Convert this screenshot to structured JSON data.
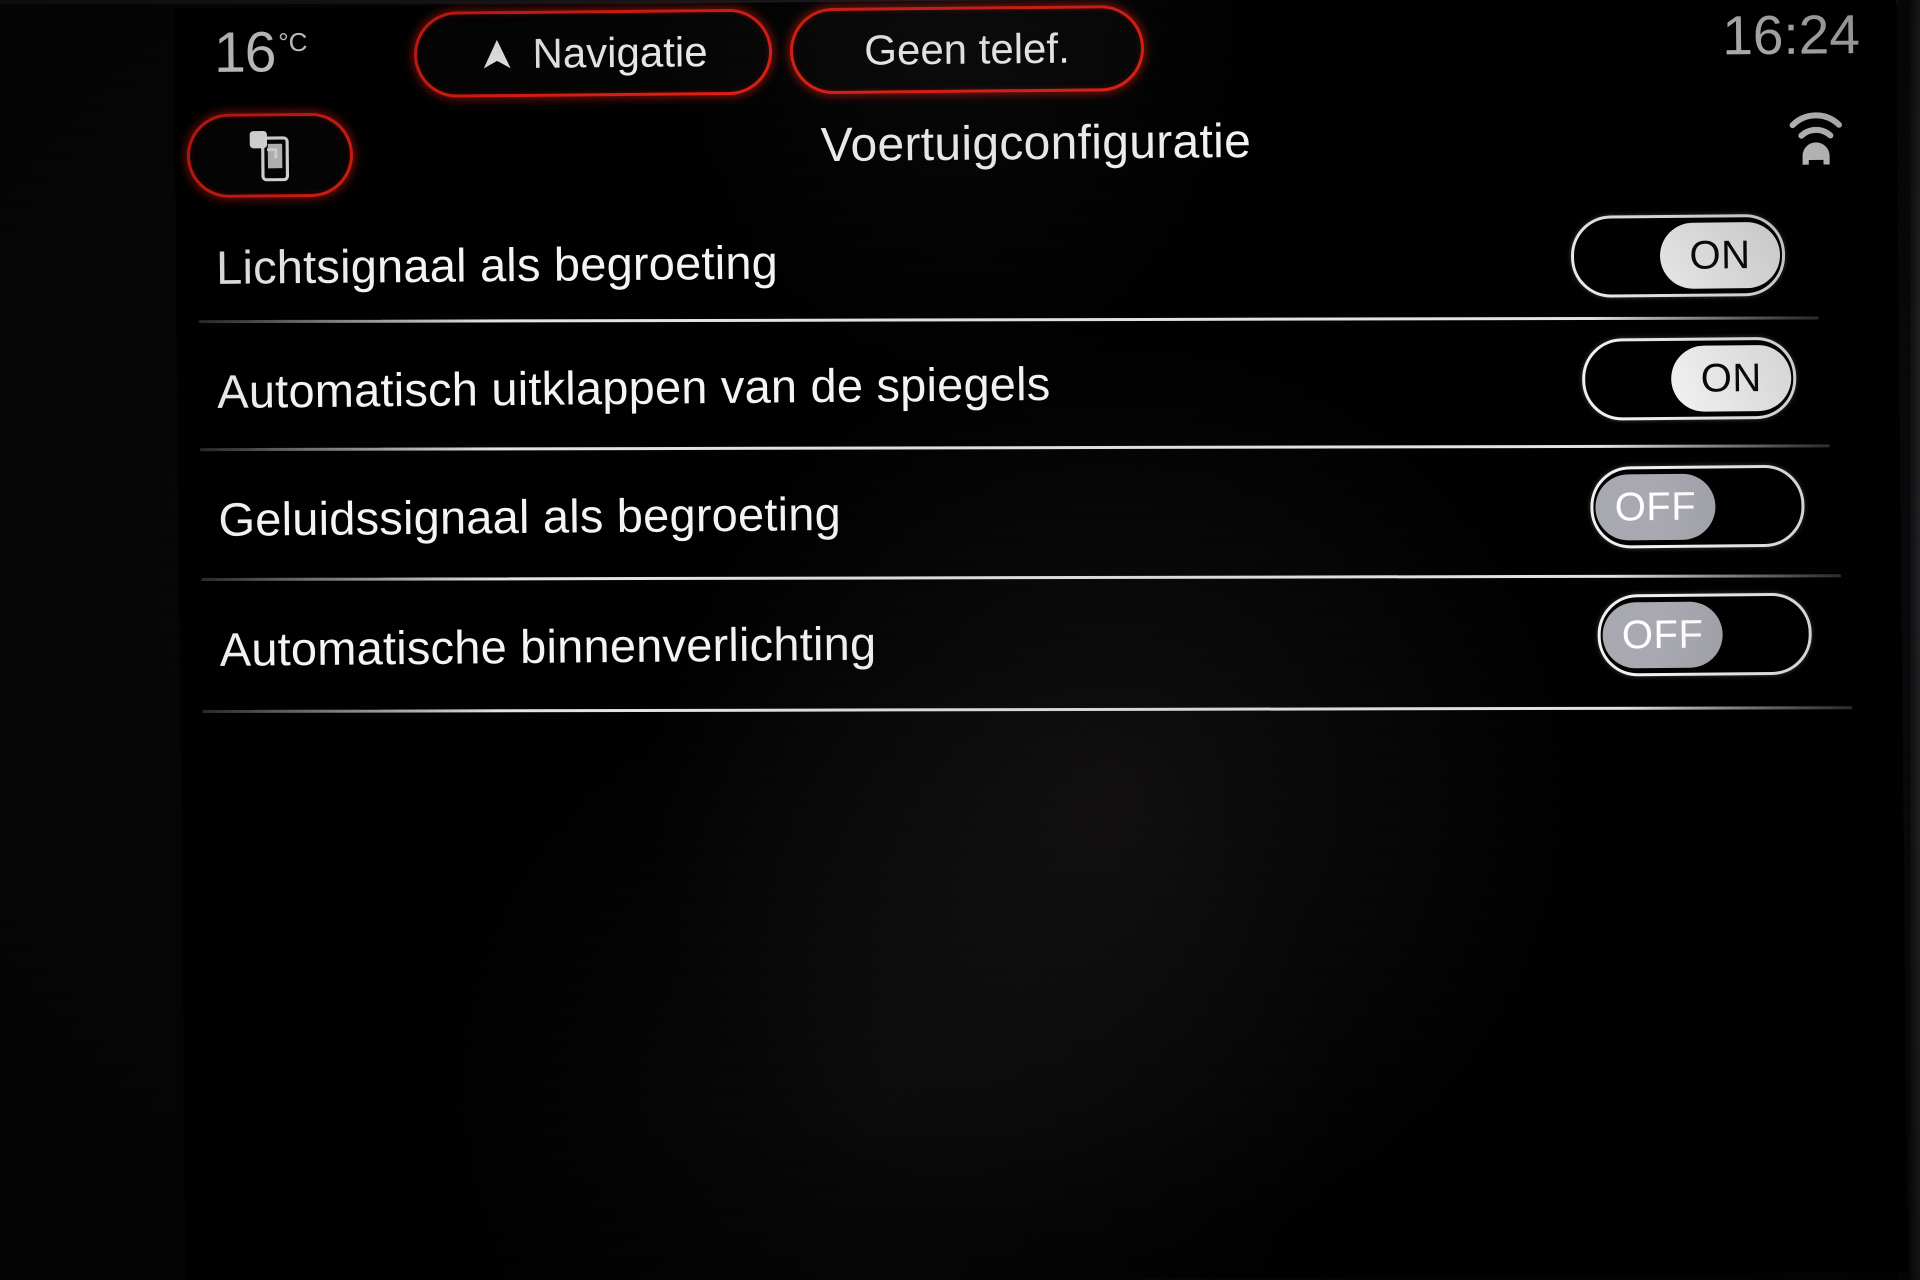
{
  "status_bar": {
    "temperature": "16",
    "temperature_unit": "°C",
    "navigation_label": "Navigatie",
    "navigation_icon": "navigation-arrow-icon",
    "phone_label": "Geen telef.",
    "clock": "16:24"
  },
  "title_bar": {
    "device_icon": "smartphone-projection-icon",
    "title": "Voertuigconfiguratie",
    "antenna_icon": "car-connected-antenna-icon"
  },
  "settings": [
    {
      "label": "Lichtsignaal als begroeting",
      "state": "ON"
    },
    {
      "label": "Automatisch uitklappen van de spiegels",
      "state": "ON"
    },
    {
      "label": "Geluidssignaal als begroeting",
      "state": "OFF"
    },
    {
      "label": "Automatische binnenverlichting",
      "state": "OFF"
    }
  ],
  "colors": {
    "accent_red": "#e01d12",
    "background": "#000000",
    "text": "#f4f4f4",
    "toggle_on_thumb": "#fafafa",
    "toggle_off_thumb": "#a8a8b0"
  }
}
